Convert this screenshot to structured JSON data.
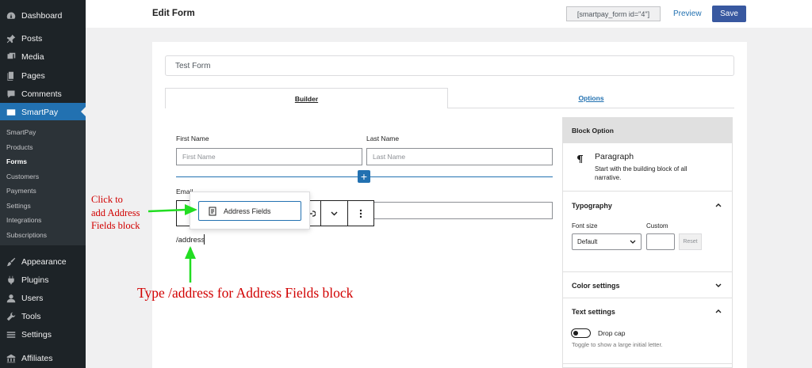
{
  "sidebar": {
    "menu": [
      {
        "label": "Dashboard",
        "icon": "dashboard-icon"
      },
      {
        "label": "Posts",
        "icon": "pin-icon"
      },
      {
        "label": "Media",
        "icon": "media-icon"
      },
      {
        "label": "Pages",
        "icon": "pages-icon"
      },
      {
        "label": "Comments",
        "icon": "comments-icon"
      },
      {
        "label": "SmartPay",
        "icon": "smartpay-icon"
      },
      {
        "label": "Appearance",
        "icon": "brush-icon"
      },
      {
        "label": "Plugins",
        "icon": "plugin-icon"
      },
      {
        "label": "Users",
        "icon": "user-icon"
      },
      {
        "label": "Tools",
        "icon": "wrench-icon"
      },
      {
        "label": "Settings",
        "icon": "settings-icon"
      },
      {
        "label": "Affiliates",
        "icon": "affiliates-icon"
      }
    ],
    "submenu": [
      "SmartPay",
      "Products",
      "Forms",
      "Customers",
      "Payments",
      "Settings",
      "Integrations",
      "Subscriptions"
    ],
    "current_submenu": "Forms"
  },
  "header": {
    "title": "Edit Form",
    "shortcode": "[smartpay_form id=\"4\"]",
    "preview_label": "Preview",
    "save_label": "Save"
  },
  "form": {
    "title_value": "Test Form",
    "tabs": [
      "Builder",
      "Options"
    ],
    "first_name_label": "First Name",
    "first_name_placeholder": "First Name",
    "last_name_label": "Last Name",
    "last_name_placeholder": "Last Name",
    "email_label": "Email",
    "slash_command": "/address",
    "popup_item": "Address Fields"
  },
  "annotations": {
    "click_hint": [
      "Click to",
      "add Address",
      "Fields block"
    ],
    "type_hint": "Type /address for Address Fields block",
    "color": "#d10000",
    "arrow_color": "#22dd22"
  },
  "block_option": {
    "header": "Block Option",
    "block_name": "Paragraph",
    "block_desc": "Start with the building block of all narrative.",
    "typography_title": "Typography",
    "font_size_label": "Font size",
    "custom_label": "Custom",
    "font_size_value": "Default",
    "reset_label": "Reset",
    "color_settings_title": "Color settings",
    "text_settings_title": "Text settings",
    "drop_cap_label": "Drop cap",
    "drop_cap_help": "Toggle to show a large initial letter."
  },
  "colors": {
    "sidebar_bg": "#1d2327",
    "accent": "#2271b1",
    "save_button": "#3858a0"
  }
}
